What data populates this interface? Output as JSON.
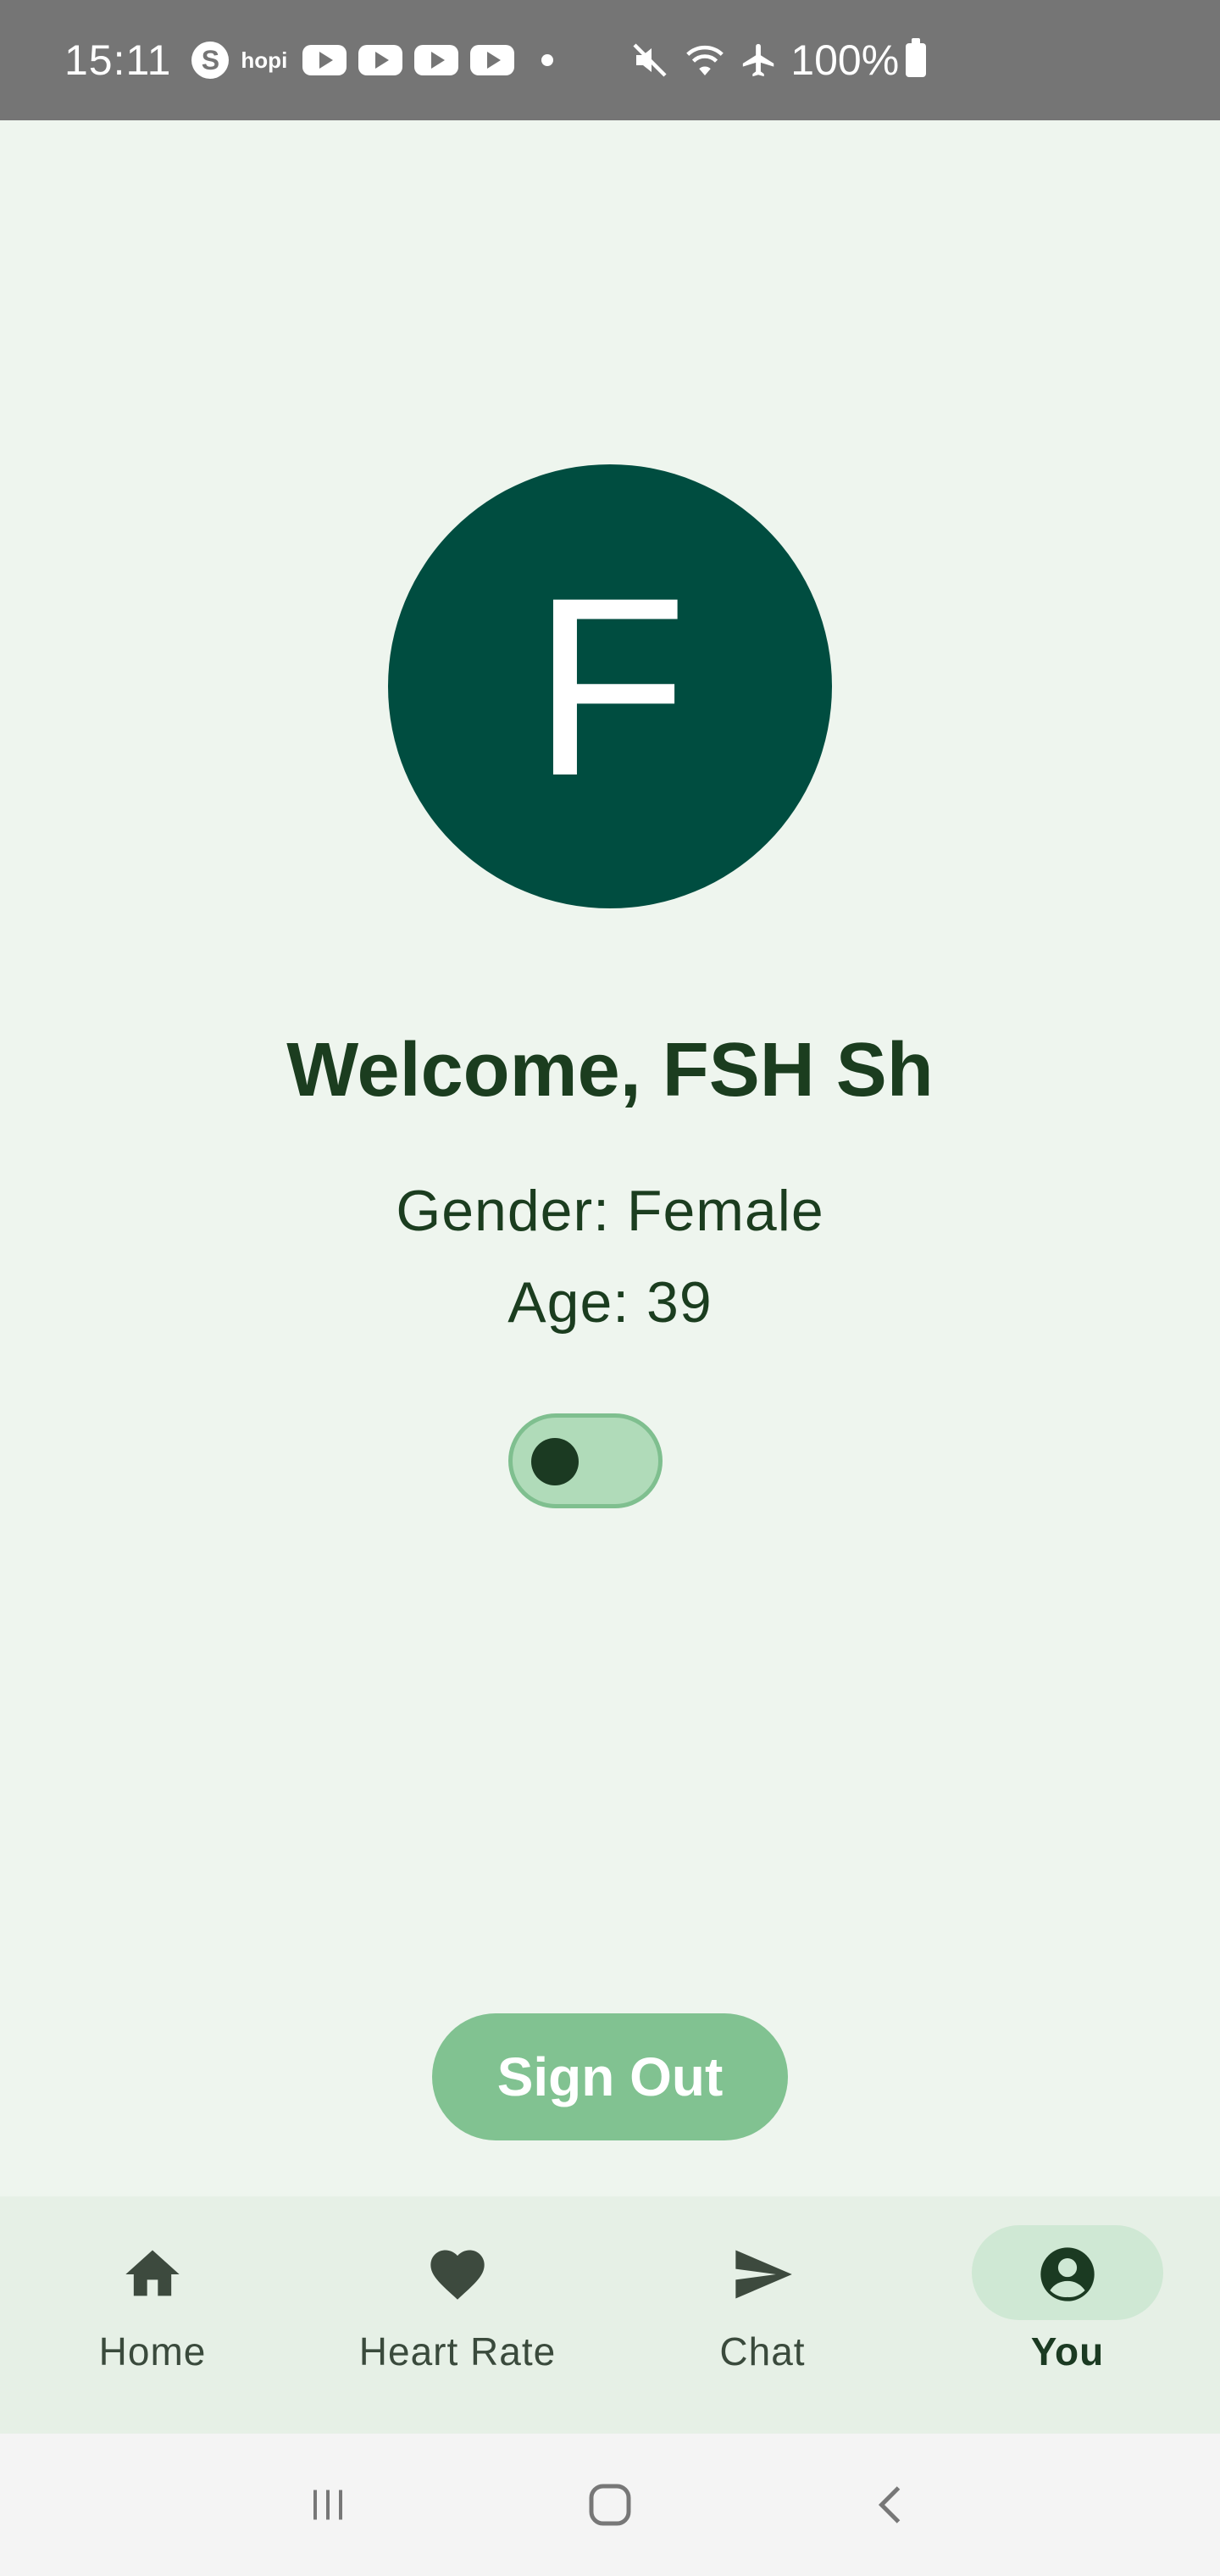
{
  "status_bar": {
    "time": "15:11",
    "hopi": "hopi",
    "battery": "100%",
    "icons": [
      "skype-icon",
      "hopi-icon",
      "youtube-icon",
      "youtube-icon",
      "youtube-icon",
      "youtube-icon",
      "dot-icon",
      "mute-icon",
      "wifi-icon",
      "airplane-icon",
      "battery-icon"
    ]
  },
  "profile": {
    "initial": "F",
    "welcome": "Welcome, FSH Sh",
    "gender": "Gender: Female",
    "age": "Age: 39",
    "toggle_on": false,
    "avatar_color": "#004d40"
  },
  "actions": {
    "sign_out": "Sign Out",
    "sign_out_color": "#81c291"
  },
  "bottom_nav": {
    "items": [
      {
        "label": "Home",
        "icon": "home-icon",
        "active": false
      },
      {
        "label": "Heart Rate",
        "icon": "heart-icon",
        "active": false
      },
      {
        "label": "Chat",
        "icon": "send-icon",
        "active": false
      },
      {
        "label": "You",
        "icon": "account-icon",
        "active": true
      }
    ]
  },
  "system_nav": {
    "icons": [
      "recent-apps-icon",
      "home-button-icon",
      "back-icon"
    ]
  }
}
